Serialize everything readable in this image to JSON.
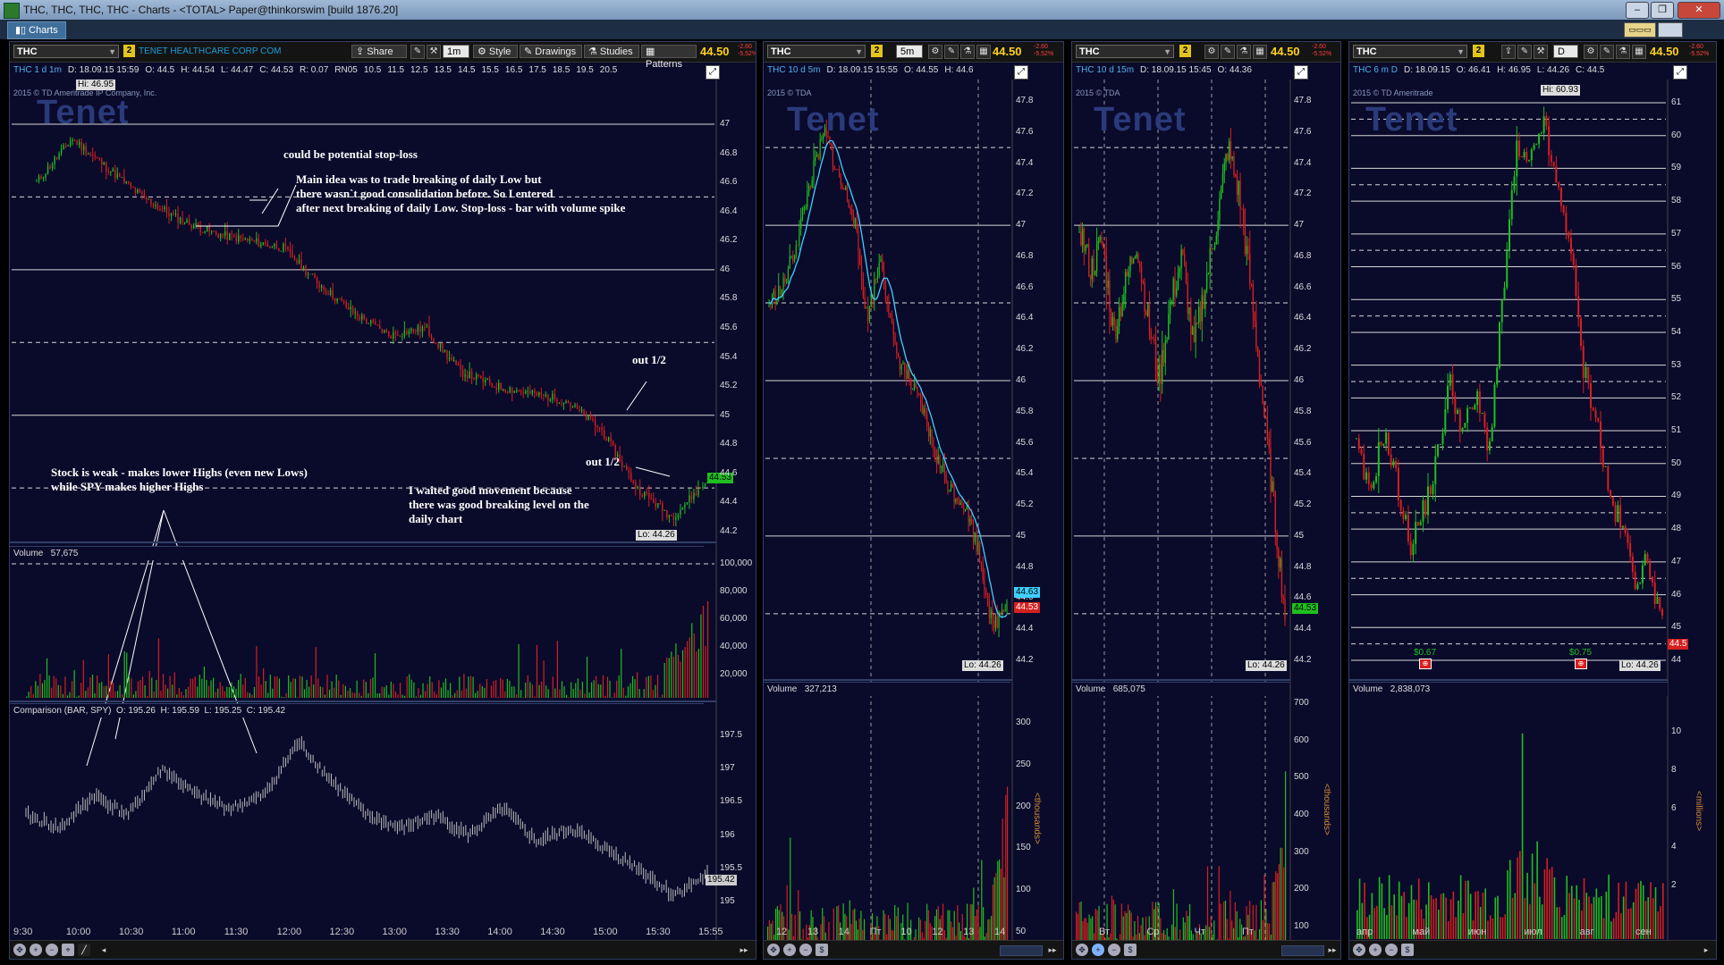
{
  "window": {
    "title": "THC, THC, THC, THC - Charts - <TOTAL> Paper@thinkorswim [build 1876.20]",
    "tab": "Charts"
  },
  "panels": [
    {
      "symbol": "THC",
      "link": "2",
      "company": "TENET HEALTHCARE CORP COM",
      "share": "Share",
      "timeframe": "1m",
      "style": "Style",
      "drawings": "Drawings",
      "studies": "Studies",
      "patterns": "Patterns",
      "last": "44.50",
      "chg1": "-2.60",
      "chg2": "-5.52%",
      "info": [
        "THC 1 d 1m",
        "D: 18.09.15 15:59",
        "O: 44.5",
        "H: 44.54",
        "L: 44.47",
        "C: 44.53",
        "R: 0.07",
        "RN05",
        "10.5",
        "11.5",
        "12.5",
        "13.5",
        "14.5",
        "15.5",
        "16.5",
        "17.5",
        "18.5",
        "19.5",
        "20.5"
      ],
      "copyright": "2015 © TD Ameritrade IP Company, Inc.",
      "watermark": "Tenet",
      "hi_label": "Hi: 46.95",
      "lo_label": "Lo: 44.26",
      "price_axis": [
        "47",
        "46.8",
        "46.6",
        "46.4",
        "46.2",
        "46",
        "45.8",
        "45.6",
        "45.4",
        "45.2",
        "45",
        "44.8",
        "44.6",
        "44.4",
        "44.2"
      ],
      "price_tag": "44.53",
      "volume_label": "Volume",
      "volume_value": "57,675",
      "volume_axis": [
        "100,000",
        "80,000",
        "60,000",
        "40,000",
        "20,000"
      ],
      "comparison_label": "Comparison (BAR, SPY)",
      "comparison_info": [
        "O: 195.26",
        "H: 195.59",
        "L: 195.25",
        "C: 195.42"
      ],
      "comparison_axis": [
        "197.5",
        "197",
        "196.5",
        "196",
        "195.5",
        "195"
      ],
      "comparison_tag": "195.42",
      "time_axis": [
        "9:30",
        "10:00",
        "10:30",
        "11:00",
        "11:30",
        "12:00",
        "12:30",
        "13:00",
        "13:30",
        "14:00",
        "14:30",
        "15:00",
        "15:30",
        "15:55"
      ],
      "annotations": {
        "stop_loss": "could be potential stop-loss",
        "main_idea": [
          "Main idea was to trade breaking of daily Low but",
          "there wasn`t good consolidation before. So I entered",
          "after next breaking of daily Low.  Stop-loss - bar with volume spike"
        ],
        "out1": "out 1/2",
        "out2": "out 1/2",
        "weak": [
          "Stock is weak - makes lower Highs (even new Lows)",
          "while SPY makes higher Highs"
        ],
        "waited": [
          "I waited good movement because",
          "there was good breaking level on the",
          "daily chart"
        ]
      }
    },
    {
      "symbol": "THC",
      "link": "2",
      "timeframe": "5m",
      "last": "44.50",
      "chg1": "-2.60",
      "chg2": "-5.52%",
      "info": [
        "THC 10 d 5m",
        "D: 18.09.15 15:55",
        "O: 44.55",
        "H: 44.6"
      ],
      "copyright": "2015 © TDA",
      "watermark": "Tenet",
      "price_axis": [
        "47.8",
        "47.6",
        "47.4",
        "47.2",
        "47",
        "46.8",
        "46.6",
        "46.4",
        "46.2",
        "46",
        "45.8",
        "45.6",
        "45.4",
        "45.2",
        "45",
        "44.8",
        "44.6",
        "44.4",
        "44.2"
      ],
      "tag_cyan": "44.63",
      "tag_red": "44.53",
      "lo_label": "Lo: 44.26",
      "volume_label": "Volume",
      "volume_value": "327,213",
      "volume_axis": [
        "300",
        "250",
        "200",
        "150",
        "100",
        "50"
      ],
      "volume_unit": "<thousands>",
      "time_axis": [
        "12",
        "13",
        "14",
        "Пт",
        "10",
        "12",
        "13",
        "14"
      ]
    },
    {
      "symbol": "THC",
      "link": "2",
      "last": "44.50",
      "chg1": "-2.60",
      "chg2": "-5.52%",
      "info": [
        "THC 10 d 15m",
        "D: 18.09.15 15:45",
        "O: 44.36"
      ],
      "copyright": "2015 © TDA",
      "watermark": "Tenet",
      "price_axis": [
        "47.8",
        "47.6",
        "47.4",
        "47.2",
        "47",
        "46.8",
        "46.6",
        "46.4",
        "46.2",
        "46",
        "45.8",
        "45.6",
        "45.4",
        "45.2",
        "45",
        "44.8",
        "44.6",
        "44.4",
        "44.2"
      ],
      "price_tag": "44.53",
      "lo_label": "Lo: 44.26",
      "volume_label": "Volume",
      "volume_value": "685,075",
      "volume_axis": [
        "700",
        "600",
        "500",
        "400",
        "300",
        "200",
        "100"
      ],
      "volume_unit": "<thousands>",
      "time_axis": [
        "Вт",
        "Ср",
        "Чт",
        "Пт"
      ]
    },
    {
      "symbol": "THC",
      "link": "2",
      "timeframe": "D",
      "last": "44.50",
      "chg1": "-2.60",
      "chg2": "-5.52%",
      "info": [
        "THC 6 m D",
        "D: 18.09.15",
        "H: 46.95",
        "L: 44.26",
        "C: 44.5"
      ],
      "info_o": "O: 46.41",
      "copyright": "2015 © TD Ameritrade",
      "watermark": "Tenet",
      "hi_label": "Hi: 60.93",
      "price_axis": [
        "61",
        "60",
        "59",
        "58",
        "57",
        "56",
        "55",
        "54",
        "53",
        "52",
        "51",
        "50",
        "49",
        "48",
        "47",
        "46",
        "45",
        "44"
      ],
      "price_tag": "44.5",
      "lo_label": "Lo: 44.26",
      "div1": "$0.67",
      "div2": "$0.75",
      "volume_label": "Volume",
      "volume_value": "2,838,073",
      "volume_axis": [
        "10",
        "8",
        "6",
        "4",
        "2"
      ],
      "volume_unit": "<millions>",
      "time_axis": [
        "апр",
        "май",
        "июн",
        "июл",
        "авг",
        "сен"
      ]
    }
  ],
  "colors": {
    "up": "#1fbf1f",
    "down": "#d42020",
    "sma": "#3fd0ff",
    "grid": "#d8d8d8",
    "bg": "#0a0a2b",
    "price": "#ffd21f"
  }
}
